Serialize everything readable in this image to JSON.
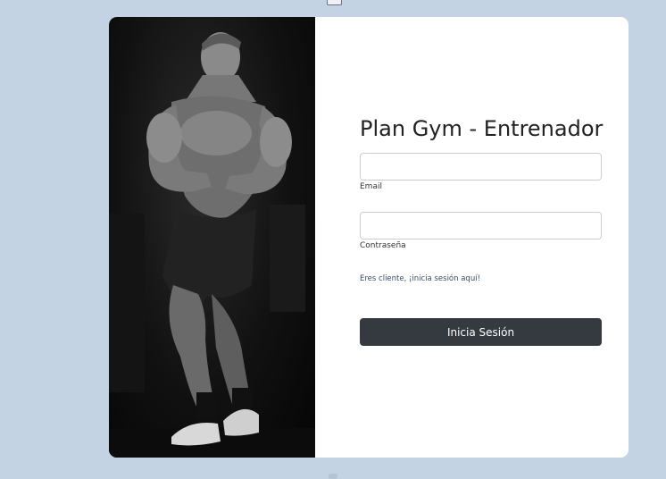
{
  "login": {
    "title": "Plan Gym - Entrenador",
    "email_label": "Email",
    "email_value": "",
    "password_label": "Contraseña",
    "password_value": "",
    "client_link": "Eres cliente, ¡inicia sesión aquí!",
    "submit_label": "Inicia Sesión"
  },
  "colors": {
    "page_bg": "#c3d3e3",
    "card_bg": "#ffffff",
    "button_bg": "#343a40",
    "link": "#3a4a6a"
  }
}
